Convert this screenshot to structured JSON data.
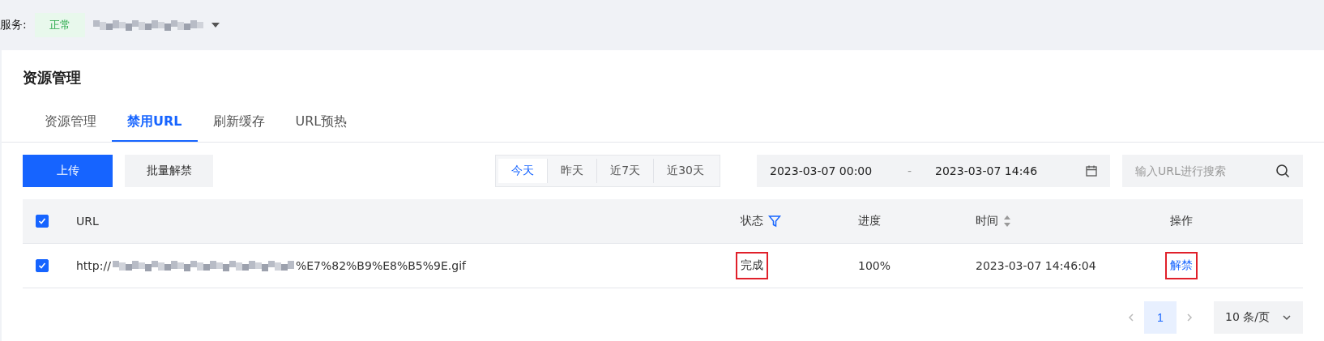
{
  "service": {
    "label": "服务:",
    "status": "正常"
  },
  "card": {
    "title": "资源管理"
  },
  "tabs": [
    {
      "label": "资源管理",
      "selected": false
    },
    {
      "label": "禁用URL",
      "selected": true
    },
    {
      "label": "刷新缓存",
      "selected": false
    },
    {
      "label": "URL预热",
      "selected": false
    }
  ],
  "buttons": [
    {
      "label": "上传",
      "kind": "primary"
    },
    {
      "label": "批量解禁",
      "kind": "secondary"
    }
  ],
  "date_presets": [
    {
      "label": "今天",
      "selected": true
    },
    {
      "label": "昨天",
      "selected": false
    },
    {
      "label": "近7天",
      "selected": false
    },
    {
      "label": "近30天",
      "selected": false
    }
  ],
  "date_range": {
    "start": "2023-03-07 00:00",
    "separator": "-",
    "end": "2023-03-07 14:46"
  },
  "search": {
    "placeholder": "输入URL进行搜索"
  },
  "table": {
    "all_checked": true,
    "columns": [
      {
        "label": "URL",
        "kind": "plain"
      },
      {
        "label": "状态",
        "kind": "filterable"
      },
      {
        "label": "进度",
        "kind": "plain"
      },
      {
        "label": "时间",
        "kind": "sortable"
      },
      {
        "label": "操作",
        "kind": "plain"
      }
    ],
    "rows": [
      {
        "checked": true,
        "url_prefix": "http://",
        "url_suffix": "%E7%82%B9%E8%B5%9E.gif",
        "status": "完成",
        "status_highlighted": true,
        "progress": "100%",
        "time": "2023-03-07 14:46:04",
        "action": "解禁",
        "action_highlighted": true
      }
    ]
  },
  "pagination": {
    "pages": [
      {
        "label": "1",
        "selected": true
      }
    ],
    "page_size": "10 条/页"
  }
}
